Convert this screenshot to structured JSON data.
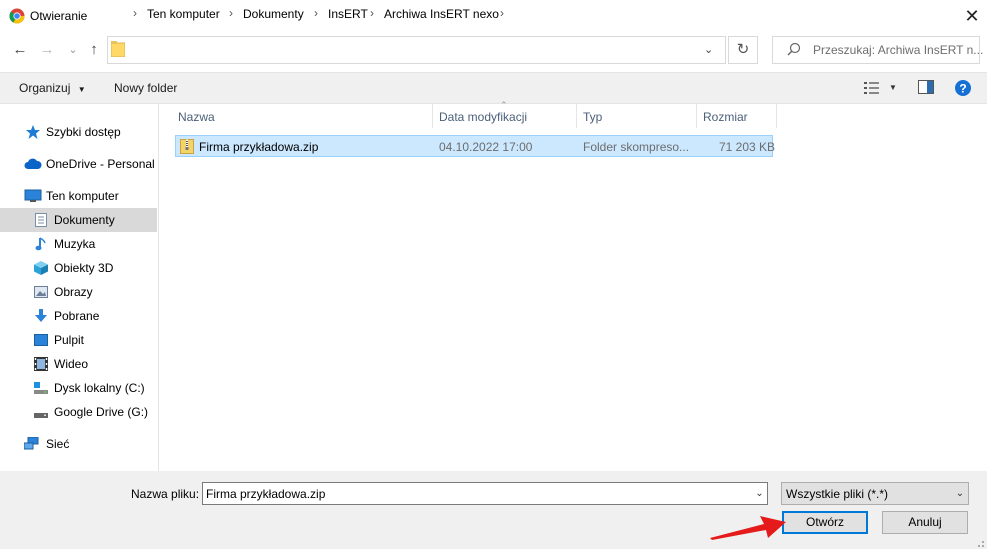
{
  "window": {
    "title": "Otwieranie",
    "close_icon": "close-icon"
  },
  "nav": {
    "back_icon": "←",
    "forward_icon": "→",
    "recent_icon": "⌄",
    "up_icon": "↑",
    "breadcrumb": [
      "Ten komputer",
      "Dokumenty",
      "InsERT",
      "Archiwa InsERT nexo"
    ],
    "refresh_icon": "↻",
    "search_placeholder": "Przeszukaj: Archiwa InsERT n..."
  },
  "toolbar": {
    "organize": "Organizuj",
    "new_folder": "Nowy folder"
  },
  "sidebar": [
    {
      "label": "Szybki dostęp",
      "icon": "star-icon",
      "color": "#1e7cd7"
    },
    {
      "label": "OneDrive - Personal",
      "icon": "cloud-icon",
      "color": "#0a64c8"
    },
    {
      "label": "Ten komputer",
      "icon": "computer-icon",
      "color": "#2b82d9"
    },
    {
      "label": "Dokumenty",
      "icon": "document-icon",
      "color": "#7a8fa6",
      "selected": true
    },
    {
      "label": "Muzyka",
      "icon": "music-icon",
      "color": "#2b82d9"
    },
    {
      "label": "Obiekty 3D",
      "icon": "cube-icon",
      "color": "#29a3d9"
    },
    {
      "label": "Obrazy",
      "icon": "picture-icon",
      "color": "#6b7f99"
    },
    {
      "label": "Pobrane",
      "icon": "download-icon",
      "color": "#2b82d9"
    },
    {
      "label": "Pulpit",
      "icon": "desktop-icon",
      "color": "#2b82d9"
    },
    {
      "label": "Wideo",
      "icon": "video-icon",
      "color": "#444"
    },
    {
      "label": "Dysk lokalny (C:)",
      "icon": "drive-icon",
      "color": "#888"
    },
    {
      "label": "Google Drive (G:)",
      "icon": "drive-icon",
      "color": "#666"
    },
    {
      "label": "Sieć",
      "icon": "network-icon",
      "color": "#2b82d9"
    }
  ],
  "columns": {
    "name": "Nazwa",
    "date": "Data modyfikacji",
    "type": "Typ",
    "size": "Rozmiar"
  },
  "files": [
    {
      "name": "Firma przykładowa.zip",
      "date": "04.10.2022 17:00",
      "type": "Folder skompreso...",
      "size": "71 203 KB"
    }
  ],
  "footer": {
    "filename_label": "Nazwa pliku:",
    "filename_value": "Firma przykładowa.zip",
    "filetype_value": "Wszystkie pliki (*.*)",
    "open_button": "Otwórz",
    "cancel_button": "Anuluj"
  },
  "colors": {
    "accent": "#0078d7",
    "selection": "#cce8ff",
    "arrow": "#e51a1a",
    "help": "#1570d6"
  }
}
